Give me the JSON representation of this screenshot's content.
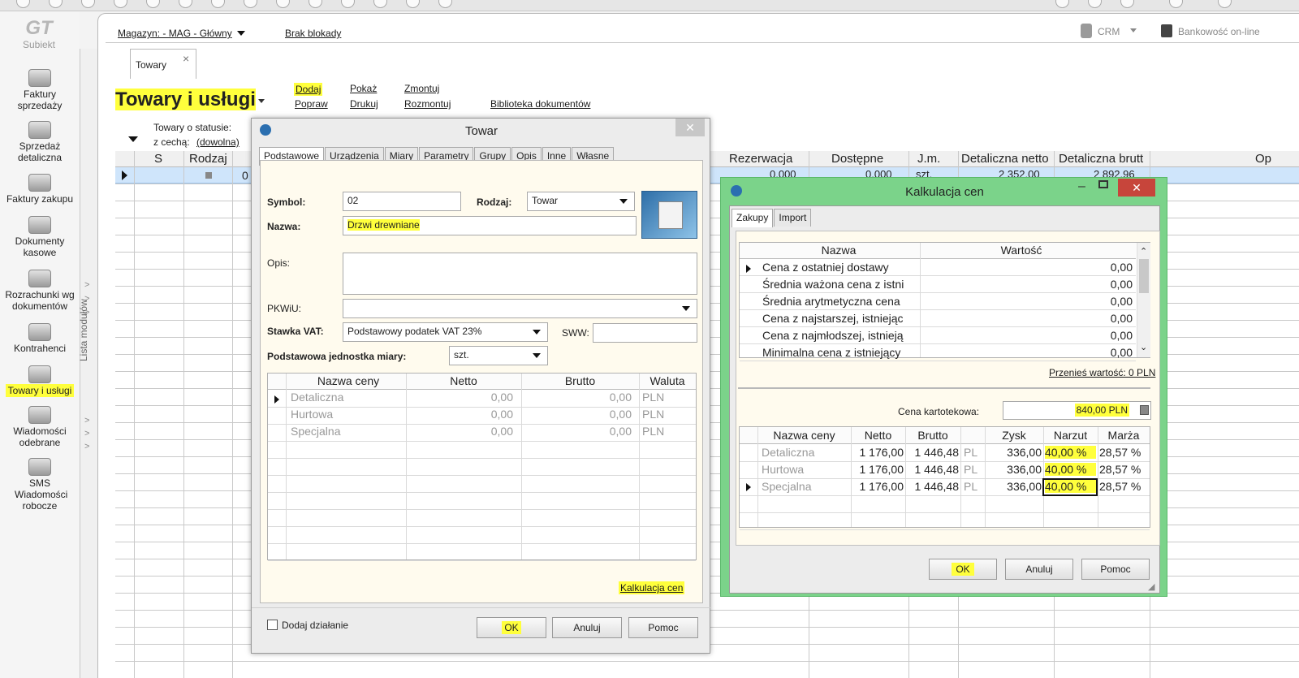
{
  "app": {
    "name": "Subiekt"
  },
  "topbar": {
    "magazyn": "Magazyn: - MAG - Główny",
    "blokada": "Brak blokady",
    "crm": "CRM",
    "bank": "Bankowość on-line"
  },
  "tab": {
    "label": "Towary",
    "close": "×"
  },
  "page": {
    "title": "Towary i usługi"
  },
  "actions": {
    "dodaj": "Dodaj",
    "popraw": "Popraw",
    "pokaz": "Pokaż",
    "drukuj": "Drukuj",
    "zmontuj": "Zmontuj",
    "rozmontuj": "Rozmontuj",
    "biblioteka": "Biblioteka dokumentów"
  },
  "filters": {
    "status_label": "Towary o statusie:",
    "cecha_label": "z cechą:",
    "cecha_value": "(dowolna)"
  },
  "sidebar": {
    "modules_label": "Lista modułów",
    "items": [
      {
        "label": "Faktury sprzedaży"
      },
      {
        "label": "Sprzedaż detaliczna"
      },
      {
        "label": "Faktury zakupu"
      },
      {
        "label": "Dokumenty kasowe"
      },
      {
        "label": "Rozrachunki wg dokumentów"
      },
      {
        "label": "Kontrahenci"
      },
      {
        "label": "Towary i usługi"
      },
      {
        "label": "Wiadomości odebrane"
      },
      {
        "label": "SMS Wiadomości robocze"
      }
    ]
  },
  "grid": {
    "columns": [
      "S",
      "Rodzaj",
      "Rezerwacja",
      "Dostępne",
      "J.m.",
      "Detaliczna netto",
      "Detaliczna brutt",
      "Op"
    ],
    "row": {
      "first": "0",
      "rezerwacja": "0,000",
      "dostepne": "0,000",
      "jm": "szt.",
      "det_netto": "2 352,00",
      "det_brutto": "2 892,96"
    }
  },
  "towar": {
    "title": "Towar",
    "tabs": [
      "Podstawowe",
      "Urządzenia",
      "Miary",
      "Parametry",
      "Grupy",
      "Opis",
      "Inne",
      "Własne"
    ],
    "symbol_label": "Symbol:",
    "symbol_value": "02",
    "rodzaj_label": "Rodzaj:",
    "rodzaj_value": "Towar",
    "nazwa_label": "Nazwa:",
    "nazwa_value": "Drzwi drewniane",
    "opis_label": "Opis:",
    "pkwiu_label": "PKWiU:",
    "vat_label": "Stawka VAT:",
    "vat_value": "Podstawowy podatek VAT 23%",
    "sww_label": "SWW:",
    "jm_label": "Podstawowa jednostka miary:",
    "jm_value": "szt.",
    "price_headers": [
      "Nazwa ceny",
      "Netto",
      "Brutto",
      "Waluta"
    ],
    "prices": [
      {
        "name": "Detaliczna",
        "netto": "0,00",
        "brutto": "0,00",
        "waluta": "PLN"
      },
      {
        "name": "Hurtowa",
        "netto": "0,00",
        "brutto": "0,00",
        "waluta": "PLN"
      },
      {
        "name": "Specjalna",
        "netto": "0,00",
        "brutto": "0,00",
        "waluta": "PLN"
      }
    ],
    "kalkulacja_link": "Kalkulacja cen",
    "dodaj_dzialanie": "Dodaj działanie",
    "ok": "OK",
    "anuluj": "Anuluj",
    "pomoc": "Pomoc"
  },
  "kalk": {
    "title": "Kalkulacja cen",
    "tabs": [
      "Zakupy",
      "Import"
    ],
    "list_headers": [
      "Nazwa",
      "Wartość"
    ],
    "list_rows": [
      {
        "name": "Cena z ostatniej dostawy",
        "value": "0,00"
      },
      {
        "name": "Średnia ważona cena z istni",
        "value": "0,00"
      },
      {
        "name": "Średnia arytmetyczna cena",
        "value": "0,00"
      },
      {
        "name": "Cena z najstarszej, istniejąc",
        "value": "0,00"
      },
      {
        "name": "Cena z najmłodszej, istnieją",
        "value": "0,00"
      },
      {
        "name": "Minimalna cena z istniejący",
        "value": "0,00"
      }
    ],
    "przenies": "Przenieś wartość: 0 PLN",
    "cena_kart_label": "Cena kartotekowa:",
    "cena_kart_value": "840,00 PLN",
    "calc_headers": [
      "Nazwa ceny",
      "Netto",
      "Brutto",
      "Zysk",
      "Narzut",
      "Marża"
    ],
    "calc_rows": [
      {
        "name": "Detaliczna",
        "netto": "1 176,00",
        "brutto": "1 446,48",
        "cur": "PL",
        "zysk": "336,00",
        "narzut": "40,00 %",
        "marza": "28,57 %"
      },
      {
        "name": "Hurtowa",
        "netto": "1 176,00",
        "brutto": "1 446,48",
        "cur": "PL",
        "zysk": "336,00",
        "narzut": "40,00 %",
        "marza": "28,57 %"
      },
      {
        "name": "Specjalna",
        "netto": "1 176,00",
        "brutto": "1 446,48",
        "cur": "PL",
        "zysk": "336,00",
        "narzut": "40,00 %",
        "marza": "28,57 %"
      }
    ],
    "ok": "OK",
    "anuluj": "Anuluj",
    "pomoc": "Pomoc"
  }
}
